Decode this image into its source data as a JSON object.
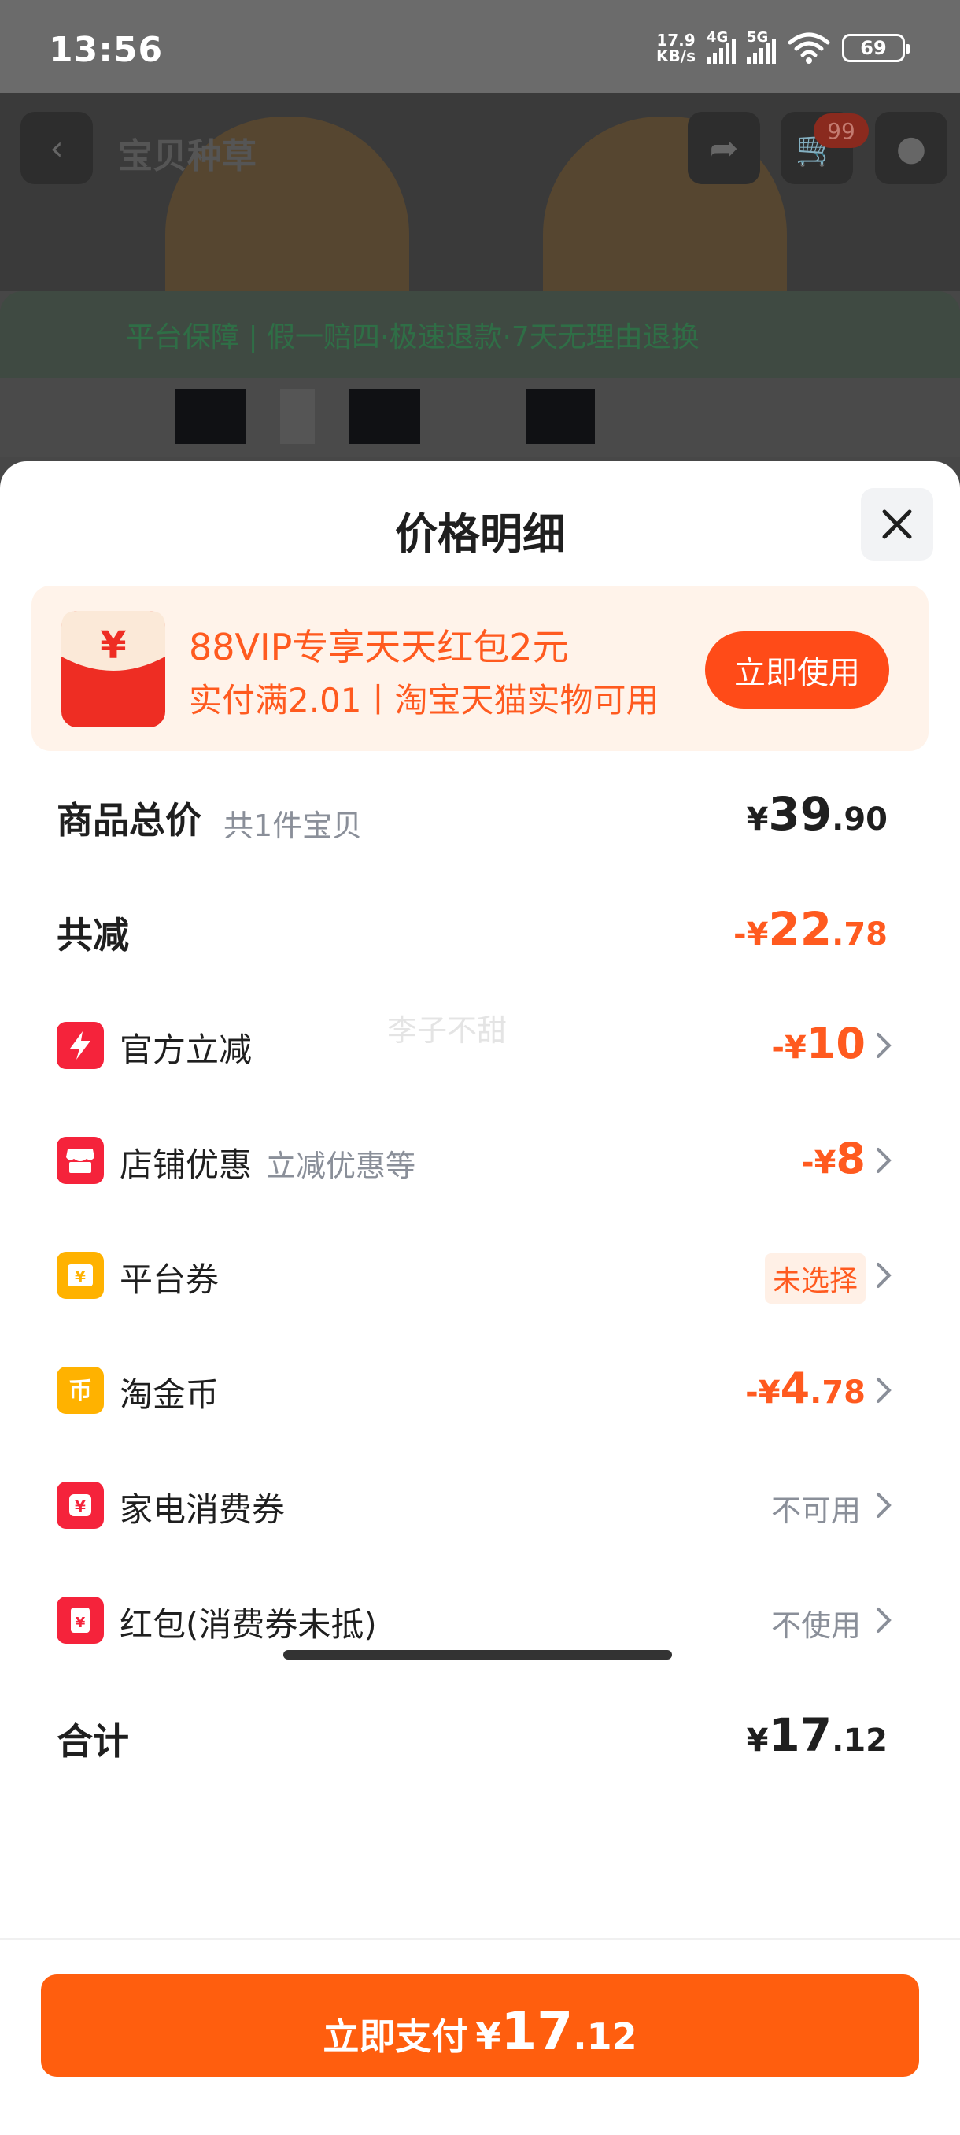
{
  "status_bar": {
    "time": "13:56",
    "net_speed_value": "17.9",
    "net_speed_unit": "KB/s",
    "signal_1": "4G",
    "signal_2": "5G",
    "battery": "69"
  },
  "background_page": {
    "title": "宝贝种草",
    "cart_badge": "99",
    "guarantee_text": "平台保障 | 假一赔四·极速退款·7天无理由退换"
  },
  "sheet": {
    "title": "价格明细",
    "promo": {
      "line1": "88VIP专享天天红包2元",
      "line2": "实付满2.01丨淘宝天猫实物可用",
      "button": "立即使用"
    },
    "total_price": {
      "label": "商品总价",
      "sub": "共1件宝贝",
      "currency": "¥",
      "int": "39",
      "dec": ".90"
    },
    "total_reduce": {
      "label": "共减",
      "prefix": "-¥",
      "int": "22",
      "dec": ".78"
    },
    "discounts": [
      {
        "label": "官方立减",
        "sublabel": "",
        "prefix": "-¥",
        "int": "10",
        "dec": "",
        "status": ""
      },
      {
        "label": "店铺优惠",
        "sublabel": "立减优惠等",
        "prefix": "-¥",
        "int": "8",
        "dec": "",
        "status": ""
      },
      {
        "label": "平台券",
        "sublabel": "",
        "prefix": "",
        "int": "",
        "dec": "",
        "status": "未选择"
      },
      {
        "label": "淘金币",
        "sublabel": "",
        "prefix": "-¥",
        "int": "4",
        "dec": ".78",
        "status": ""
      },
      {
        "label": "家电消费券",
        "sublabel": "",
        "prefix": "",
        "int": "",
        "dec": "",
        "status": "不可用"
      },
      {
        "label": "红包(消费券未抵)",
        "sublabel": "",
        "prefix": "",
        "int": "",
        "dec": "",
        "status": "不使用"
      }
    ],
    "grand_total": {
      "label": "合计",
      "currency": "¥",
      "int": "17",
      "dec": ".12"
    },
    "watermark": "李子不甜",
    "pay_button": {
      "label": "立即支付",
      "currency": "¥",
      "int": "17",
      "dec": ".12"
    }
  },
  "colors": {
    "accent_orange": "#ff5a1f",
    "pay_button": "#ff5e0e",
    "icon_red": "#f5233b",
    "icon_yellow": "#ffb200"
  },
  "icons": {
    "official": "lightning-icon",
    "shop": "store-icon",
    "platform_coupon": "coupon-icon",
    "coins": "coin-icon",
    "appliance": "appliance-coupon-icon",
    "redpacket": "red-packet-icon"
  }
}
